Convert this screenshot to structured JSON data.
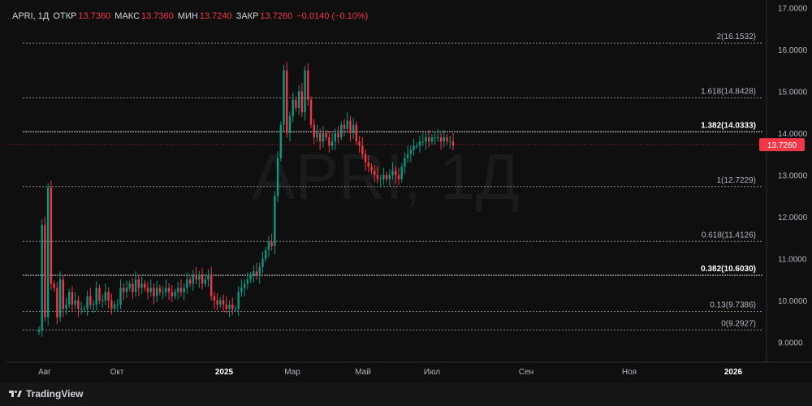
{
  "header": {
    "symbol": "APRI, 1Д",
    "open_label": "ОТКР",
    "open_value": "13.7360",
    "high_label": "МАКС",
    "high_value": "13.7360",
    "low_label": "МИН",
    "low_value": "13.7240",
    "close_label": "ЗАКР",
    "close_value": "13.7260",
    "change": "−0.0140 (−0.10%)"
  },
  "watermark": "APRI, 1Д",
  "price_tag": "13.7260",
  "brand": "TradingView",
  "colors": {
    "up": "#089981",
    "down": "#f23645",
    "background": "#0f0f0f",
    "text": "#d1d4dc",
    "axis_text": "#b2b5be"
  },
  "chart_data": {
    "type": "candlestick",
    "y_axis": {
      "ticks": [
        "9.0000",
        "10.0000",
        "11.0000",
        "12.0000",
        "13.0000",
        "14.0000",
        "15.0000",
        "16.0000",
        "17.0000"
      ],
      "ylim": [
        8.6,
        17.0
      ]
    },
    "x_axis": {
      "ticks": [
        {
          "label": "Авг",
          "x": "2024-08"
        },
        {
          "label": "Окт",
          "x": "2024-10"
        },
        {
          "label": "2025",
          "x": "2025-01",
          "bold": true
        },
        {
          "label": "Мар",
          "x": "2025-03"
        },
        {
          "label": "Май",
          "x": "2025-05"
        },
        {
          "label": "Июл",
          "x": "2025-07"
        },
        {
          "label": "Сен",
          "x": "2025-09"
        },
        {
          "label": "Ноя",
          "x": "2025-11"
        },
        {
          "label": "2026",
          "x": "2026-01",
          "bold": true
        }
      ]
    },
    "fib_levels": [
      {
        "label": "2(16.1532)",
        "value": 16.1532
      },
      {
        "label": "1.618(14.8428)",
        "value": 14.8428
      },
      {
        "label": "1.382(14.0333)",
        "value": 14.0333,
        "highlight": true
      },
      {
        "label": "1(12.7229)",
        "value": 12.7229
      },
      {
        "label": "0.618(11.4126)",
        "value": 11.4126
      },
      {
        "label": "0.382(10.6030)",
        "value": 10.603,
        "highlight": true
      },
      {
        "label": "0.13(9.7386)",
        "value": 9.7386
      },
      {
        "label": "0(9.2927)",
        "value": 9.2927
      }
    ],
    "last_price": 13.726,
    "series": [
      {
        "segment": "Jul–Aug 2024",
        "values": [
          9.3,
          11.8,
          9.6,
          12.7,
          10.4,
          10.3,
          9.6,
          10.5,
          9.8,
          9.9,
          10.2,
          9.9,
          10.0,
          9.8,
          9.8,
          9.8,
          10.1,
          9.9,
          9.9,
          10.3,
          10.0,
          10.0,
          10.2,
          10.0
        ]
      },
      {
        "segment": "Sep–Oct 2024",
        "values": [
          9.8,
          9.9,
          9.9,
          10.3,
          10.2,
          10.3,
          10.4,
          10.2,
          10.5,
          10.3,
          10.4,
          10.3,
          10.2,
          10.3,
          10.1,
          10.3,
          10.2,
          10.2,
          10.3,
          10.2,
          10.1,
          10.2,
          10.3,
          10.2
        ]
      },
      {
        "segment": "Nov–Dec 2024",
        "values": [
          10.3,
          10.5,
          10.4,
          10.6,
          10.5,
          10.6,
          10.4,
          10.5,
          10.6,
          10.1,
          10.0,
          9.9,
          10.0,
          9.9,
          9.8,
          9.9,
          9.8,
          9.8,
          10.2,
          10.3,
          10.4,
          10.5,
          10.6,
          10.7
        ]
      },
      {
        "segment": "Jan 2025",
        "values": [
          10.6,
          10.8,
          11.0,
          11.2,
          11.4,
          11.3,
          12.5,
          13.4,
          14.2,
          15.5,
          14.0,
          14.4,
          14.8,
          14.6,
          15.0,
          14.5,
          15.5,
          14.8,
          14.2,
          13.9,
          14.0,
          13.8
        ]
      },
      {
        "segment": "Mar–Apr 2025",
        "values": [
          14.0,
          13.9,
          13.7,
          13.8,
          14.0,
          13.9,
          14.2,
          14.1,
          14.3,
          14.0,
          14.2,
          13.8,
          13.7,
          13.5,
          13.3,
          13.2,
          13.1,
          13.0,
          12.9,
          12.9,
          13.0,
          12.9,
          13.0,
          13.1
        ]
      },
      {
        "segment": "May–Jul 2025",
        "values": [
          13.0,
          12.9,
          13.2,
          13.4,
          13.5,
          13.6,
          13.7,
          13.7,
          13.8,
          13.8,
          13.9,
          13.8,
          13.9,
          13.9,
          13.9,
          13.8,
          13.9,
          13.8,
          13.8,
          13.7
        ]
      }
    ]
  }
}
